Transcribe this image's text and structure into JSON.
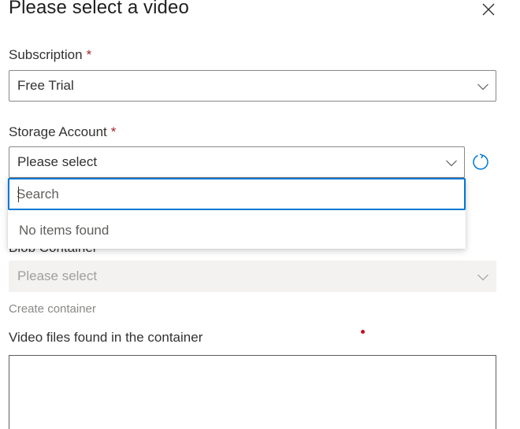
{
  "dialog": {
    "title": "Please select a video"
  },
  "subscription": {
    "label": "Subscription",
    "required_mark": "*",
    "value": "Free Trial"
  },
  "storage_account": {
    "label": "Storage Account",
    "required_mark": "*",
    "value": "Please select",
    "dropdown": {
      "search_placeholder": "Search",
      "empty_message": "No items found"
    }
  },
  "blob_container": {
    "label": "Blob Container",
    "value": "Please select",
    "create_link": "Create container"
  },
  "video_files": {
    "label": "Video files found in the container"
  },
  "icons": {
    "close": "close-icon",
    "chevron": "chevron-down-icon",
    "refresh": "refresh-icon"
  },
  "colors": {
    "accent": "#0078d4",
    "required": "#a4262c",
    "disabled_bg": "#f3f2f1"
  }
}
